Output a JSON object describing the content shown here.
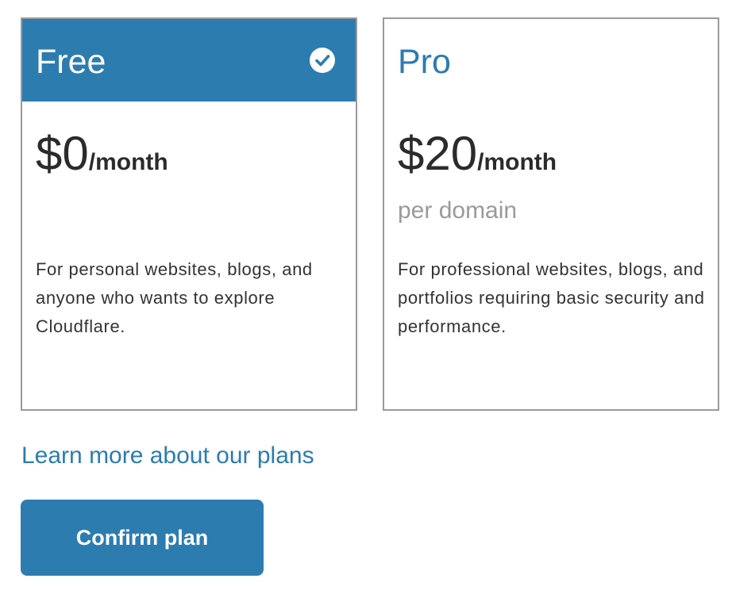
{
  "plans": [
    {
      "name": "Free",
      "selected": true,
      "price_amount": "$0",
      "price_period": "/month",
      "price_note": "",
      "description": "For personal websites, blogs, and anyone who wants to explore Cloudflare."
    },
    {
      "name": "Pro",
      "selected": false,
      "price_amount": "$20",
      "price_period": "/month",
      "price_note": "per domain",
      "description": "For professional websites, blogs, and portfolios requiring basic security and performance."
    }
  ],
  "learn_more_link": "Learn more about our plans",
  "confirm_button_label": "Confirm plan",
  "icons": {
    "selected": "check-circle-icon"
  },
  "colors": {
    "accent": "#2c7cb0",
    "border": "#9a9a9a",
    "muted_text": "#9a9a9a",
    "body_text": "#333333"
  }
}
